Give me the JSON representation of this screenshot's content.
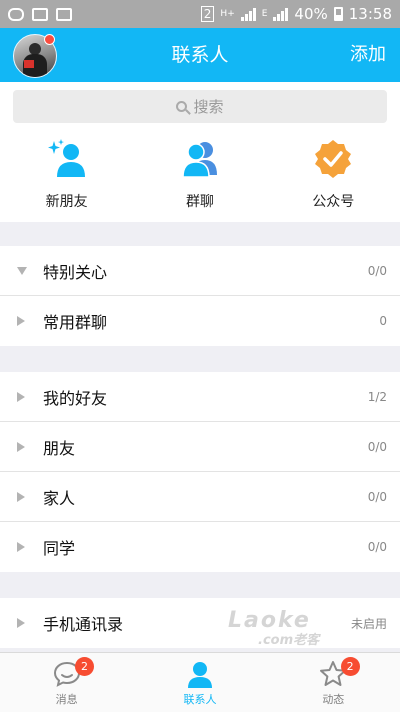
{
  "status_bar": {
    "battery_text": "40%",
    "time": "13:58",
    "sim_slot": "2",
    "network_type_1": "H+",
    "network_type_2": "E"
  },
  "header": {
    "title": "联系人",
    "add_label": "添加"
  },
  "search": {
    "placeholder": "搜索"
  },
  "shortcuts": [
    {
      "label": "新朋友",
      "icon": "new-friend-icon"
    },
    {
      "label": "群聊",
      "icon": "group-chat-icon"
    },
    {
      "label": "公众号",
      "icon": "official-account-icon"
    }
  ],
  "groups": [
    {
      "rows": [
        {
          "label": "特别关心",
          "count": "0/0",
          "expanded": true
        },
        {
          "label": "常用群聊",
          "count": "0",
          "expanded": false
        }
      ]
    },
    {
      "rows": [
        {
          "label": "我的好友",
          "count": "1/2",
          "expanded": false
        },
        {
          "label": "朋友",
          "count": "0/0",
          "expanded": false
        },
        {
          "label": "家人",
          "count": "0/0",
          "expanded": false
        },
        {
          "label": "同学",
          "count": "0/0",
          "expanded": false
        }
      ]
    },
    {
      "rows": [
        {
          "label": "手机通讯录",
          "count": "未启用",
          "expanded": false
        }
      ]
    }
  ],
  "watermark": {
    "top": "Laoke",
    "bottom": ".com老客"
  },
  "tabs": [
    {
      "label": "消息",
      "badge": "2",
      "icon": "message-icon",
      "active": false
    },
    {
      "label": "联系人",
      "badge": "",
      "icon": "contacts-icon",
      "active": true
    },
    {
      "label": "动态",
      "badge": "2",
      "icon": "star-icon",
      "active": false
    }
  ],
  "colors": {
    "accent": "#12b7f5",
    "badge": "#f74c31",
    "official_account": "#f5a23a"
  }
}
